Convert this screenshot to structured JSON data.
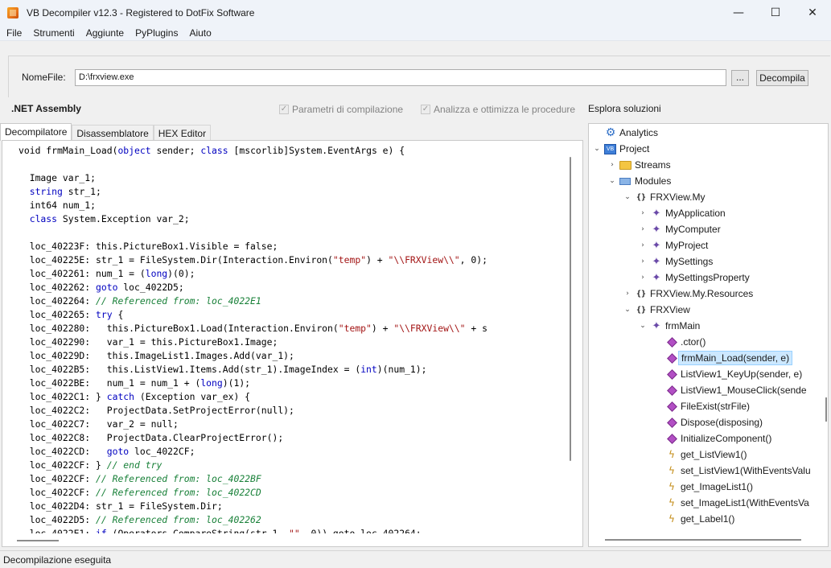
{
  "window": {
    "title": "VB Decompiler v12.3 - Registered to DotFix Software",
    "minimize": "—",
    "maximize": "☐",
    "close": "✕"
  },
  "menu": [
    "File",
    "Strumenti",
    "Aggiunte",
    "PyPlugins",
    "Aiuto"
  ],
  "file": {
    "label": "NomeFile:",
    "value": "D:\\frxview.exe",
    "browse_label": "...",
    "decompile_label": "Decompila"
  },
  "assembly_label": ".NET Assembly",
  "options": {
    "compile_params": "Parametri di compilazione",
    "analyze_optimize": "Analizza e ottimizza le procedure"
  },
  "explorer_label": "Esplora soluzioni",
  "tabs": [
    "Decompilatore",
    "Disassemblatore",
    "HEX Editor"
  ],
  "code_lines": [
    [
      [
        "",
        "void frmMain_Load("
      ],
      [
        "kw",
        "object"
      ],
      [
        "",
        " sender; "
      ],
      [
        "kw",
        "class"
      ],
      [
        "",
        " [mscorlib]System.EventArgs e) {"
      ]
    ],
    [],
    [
      [
        "",
        "  Image var_1;"
      ]
    ],
    [
      [
        "",
        "  "
      ],
      [
        "kw",
        "string"
      ],
      [
        "",
        " str_1;"
      ]
    ],
    [
      [
        "",
        "  int64 num_1;"
      ]
    ],
    [
      [
        "",
        "  "
      ],
      [
        "kw",
        "class"
      ],
      [
        "",
        " System.Exception var_2;"
      ]
    ],
    [],
    [
      [
        "",
        "  loc_40223F: this.PictureBox1.Visible = false;"
      ]
    ],
    [
      [
        "",
        "  loc_40225E: str_1 = FileSystem.Dir(Interaction.Environ("
      ],
      [
        "str",
        "\"temp\""
      ],
      [
        "",
        ") + "
      ],
      [
        "str",
        "\"\\\\FRXView\\\\\""
      ],
      [
        "",
        ", 0);"
      ]
    ],
    [
      [
        "",
        "  loc_402261: num_1 = ("
      ],
      [
        "kw",
        "long"
      ],
      [
        "",
        ")(0);"
      ]
    ],
    [
      [
        "",
        "  loc_402262: "
      ],
      [
        "kw",
        "goto"
      ],
      [
        "",
        " loc_4022D5;"
      ]
    ],
    [
      [
        "",
        "  loc_402264: "
      ],
      [
        "cm",
        "// Referenced from: loc_4022E1"
      ]
    ],
    [
      [
        "",
        "  loc_402265: "
      ],
      [
        "kw",
        "try"
      ],
      [
        "",
        " {"
      ]
    ],
    [
      [
        "",
        "  loc_402280:   this.PictureBox1.Load(Interaction.Environ("
      ],
      [
        "str",
        "\"temp\""
      ],
      [
        "",
        ") + "
      ],
      [
        "str",
        "\"\\\\FRXView\\\\\""
      ],
      [
        "",
        " + s"
      ]
    ],
    [
      [
        "",
        "  loc_402290:   var_1 = this.PictureBox1.Image;"
      ]
    ],
    [
      [
        "",
        "  loc_40229D:   this.ImageList1.Images.Add(var_1);"
      ]
    ],
    [
      [
        "",
        "  loc_4022B5:   this.ListView1.Items.Add(str_1).ImageIndex = ("
      ],
      [
        "kw",
        "int"
      ],
      [
        "",
        ")(num_1);"
      ]
    ],
    [
      [
        "",
        "  loc_4022BE:   num_1 = num_1 + ("
      ],
      [
        "kw",
        "long"
      ],
      [
        "",
        ")(1);"
      ]
    ],
    [
      [
        "",
        "  loc_4022C1: } "
      ],
      [
        "kw",
        "catch"
      ],
      [
        "",
        " (Exception var_ex) {"
      ]
    ],
    [
      [
        "",
        "  loc_4022C2:   ProjectData.SetProjectError(null);"
      ]
    ],
    [
      [
        "",
        "  loc_4022C7:   var_2 = null;"
      ]
    ],
    [
      [
        "",
        "  loc_4022C8:   ProjectData.ClearProjectError();"
      ]
    ],
    [
      [
        "",
        "  loc_4022CD:   "
      ],
      [
        "kw",
        "goto"
      ],
      [
        "",
        " loc_4022CF;"
      ]
    ],
    [
      [
        "",
        "  loc_4022CF: } "
      ],
      [
        "cm",
        "// end try"
      ]
    ],
    [
      [
        "",
        "  loc_4022CF: "
      ],
      [
        "cm",
        "// Referenced from: loc_4022BF"
      ]
    ],
    [
      [
        "",
        "  loc_4022CF: "
      ],
      [
        "cm",
        "// Referenced from: loc_4022CD"
      ]
    ],
    [
      [
        "",
        "  loc_4022D4: str_1 = FileSystem.Dir;"
      ]
    ],
    [
      [
        "",
        "  loc_4022D5: "
      ],
      [
        "cm",
        "// Referenced from: loc_402262"
      ]
    ],
    [
      [
        "",
        "  loc_4022E1: "
      ],
      [
        "kw",
        "if"
      ],
      [
        "",
        " (Operators.CompareString(str_1, "
      ],
      [
        "str",
        "\"\""
      ],
      [
        "",
        ", 0)) goto loc_402264;"
      ]
    ]
  ],
  "tree": [
    {
      "label": "Analytics",
      "icon": "analytics-icon",
      "indent": 0,
      "chev": "",
      "selected": false
    },
    {
      "label": "Project",
      "icon": "project-icon",
      "indent": 0,
      "chev": "⌄",
      "selected": false
    },
    {
      "label": "Streams",
      "icon": "folder-icon",
      "indent": 1,
      "chev": "›",
      "selected": false
    },
    {
      "label": "Modules",
      "icon": "modules-icon",
      "indent": 1,
      "chev": "⌄",
      "selected": false
    },
    {
      "label": "FRXView.My",
      "icon": "namespace-icon",
      "indent": 2,
      "chev": "⌄",
      "selected": false
    },
    {
      "label": "MyApplication",
      "icon": "property-icon",
      "indent": 3,
      "chev": "›",
      "selected": false
    },
    {
      "label": "MyComputer",
      "icon": "property-icon",
      "indent": 3,
      "chev": "›",
      "selected": false
    },
    {
      "label": "MyProject",
      "icon": "property-icon",
      "indent": 3,
      "chev": "›",
      "selected": false
    },
    {
      "label": "MySettings",
      "icon": "property-icon",
      "indent": 3,
      "chev": "›",
      "selected": false
    },
    {
      "label": "MySettingsProperty",
      "icon": "property-icon",
      "indent": 3,
      "chev": "›",
      "selected": false
    },
    {
      "label": "FRXView.My.Resources",
      "icon": "namespace-icon",
      "indent": 2,
      "chev": "›",
      "selected": false
    },
    {
      "label": "FRXView",
      "icon": "namespace-icon",
      "indent": 2,
      "chev": "⌄",
      "selected": false
    },
    {
      "label": "frmMain",
      "icon": "property-icon",
      "indent": 3,
      "chev": "⌄",
      "selected": false
    },
    {
      "label": ".ctor()",
      "icon": "method-icon",
      "indent": 4,
      "chev": "",
      "selected": false
    },
    {
      "label": "frmMain_Load(sender, e)",
      "icon": "method-icon",
      "indent": 4,
      "chev": "",
      "selected": true
    },
    {
      "label": "ListView1_KeyUp(sender, e)",
      "icon": "method-icon",
      "indent": 4,
      "chev": "",
      "selected": false
    },
    {
      "label": "ListView1_MouseClick(sende",
      "icon": "method-icon",
      "indent": 4,
      "chev": "",
      "selected": false
    },
    {
      "label": "FileExist(strFile)",
      "icon": "method-icon",
      "indent": 4,
      "chev": "",
      "selected": false
    },
    {
      "label": "Dispose(disposing)",
      "icon": "method-icon",
      "indent": 4,
      "chev": "",
      "selected": false
    },
    {
      "label": "InitializeComponent()",
      "icon": "method-icon",
      "indent": 4,
      "chev": "",
      "selected": false
    },
    {
      "label": "get_ListView1()",
      "icon": "event-icon",
      "indent": 4,
      "chev": "",
      "selected": false
    },
    {
      "label": "set_ListView1(WithEventsValu",
      "icon": "event-icon",
      "indent": 4,
      "chev": "",
      "selected": false
    },
    {
      "label": "get_ImageList1()",
      "icon": "event-icon",
      "indent": 4,
      "chev": "",
      "selected": false
    },
    {
      "label": "set_ImageList1(WithEventsVa",
      "icon": "event-icon",
      "indent": 4,
      "chev": "",
      "selected": false
    },
    {
      "label": "get_Label1()",
      "icon": "event-icon",
      "indent": 4,
      "chev": "",
      "selected": false
    }
  ],
  "status": "Decompilazione eseguita"
}
